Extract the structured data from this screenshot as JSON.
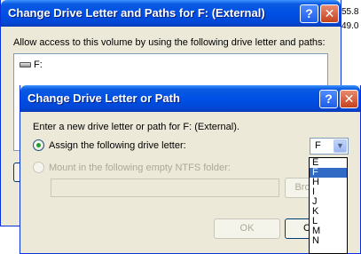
{
  "background": {
    "text_1": "55.8",
    "text_2": "49.0"
  },
  "back_dialog": {
    "title": "Change Drive Letter and Paths for F: (External)",
    "help_glyph": "?",
    "close_glyph": "✕",
    "instructions": "Allow access to this volume by using the following drive letter and paths:",
    "list_items": [
      {
        "label": "F:",
        "icon": "drive-icon"
      }
    ]
  },
  "front_dialog": {
    "title": "Change Drive Letter or Path",
    "help_glyph": "?",
    "close_glyph": "✕",
    "description": "Enter a new drive letter or path for F: (External).",
    "assign_letter_label": "Assign the following drive letter:",
    "assign_letter_checked": true,
    "selected_letter": "F",
    "mount_folder_label": "Mount in the following empty NTFS folder:",
    "mount_folder_enabled": false,
    "folder_path_value": "",
    "browse_button": "Bro",
    "ok_button": "OK",
    "cancel_button": "Ca",
    "dropdown_options": [
      "E",
      "F",
      "H",
      "I",
      "J",
      "K",
      "L",
      "M",
      "N"
    ],
    "dropdown_selected_index": 1
  },
  "colors": {
    "title_bar_blue": "#0050e6",
    "dialog_face": "#ece9d8",
    "selection_blue": "#316ac5",
    "radio_dot_green": "#21a121"
  }
}
